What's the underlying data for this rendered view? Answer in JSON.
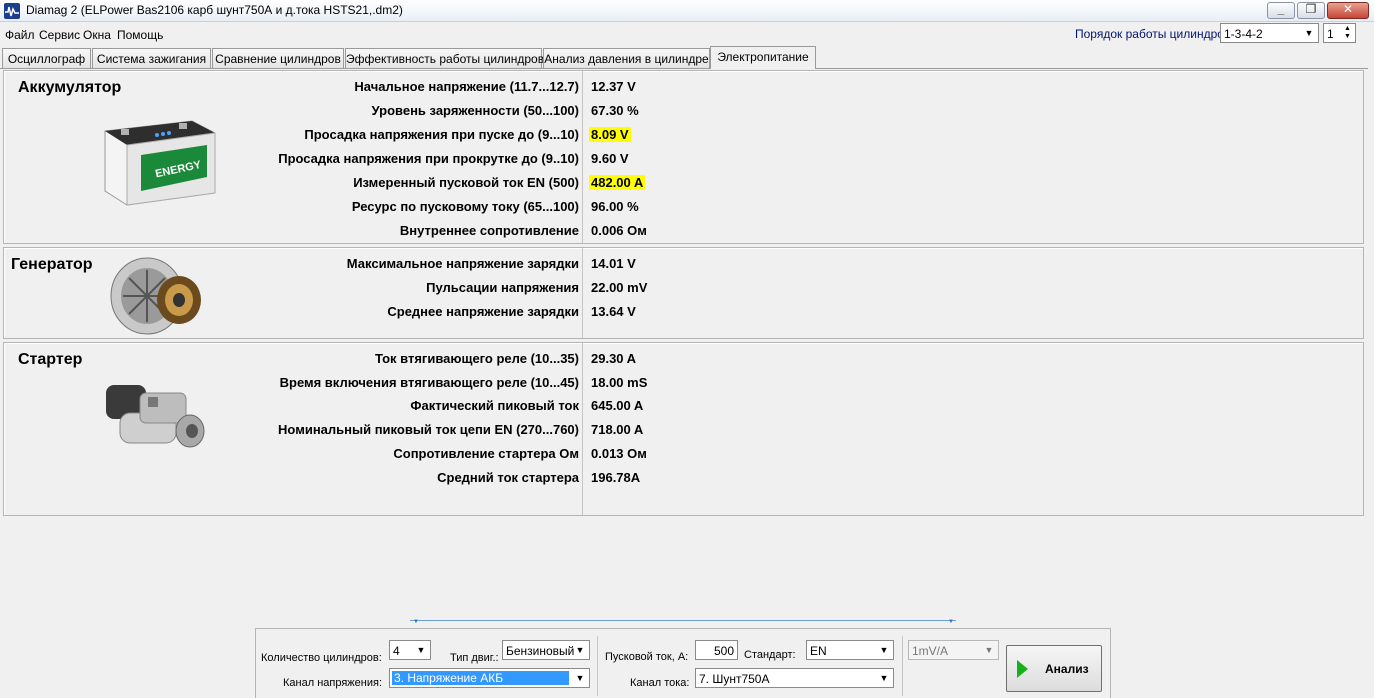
{
  "window": {
    "title": "Diamag 2 (ELPower Bas2106 карб шунт750А и д.тока HSTS21,.dm2)",
    "btn_min": "_",
    "btn_max": "❐",
    "btn_close": "✕"
  },
  "menu": [
    "Файл",
    "Сервис",
    "Окна",
    "Помощь"
  ],
  "cylinder_order": {
    "label": "Порядок работы цилиндров",
    "value": "1-3-4-2",
    "spin_value": "1"
  },
  "tabs": [
    {
      "label": "Осциллограф"
    },
    {
      "label": "Система зажигания"
    },
    {
      "label": "Сравнение цилиндров"
    },
    {
      "label": "Эффективность работы цилиндров"
    },
    {
      "label": "Анализ давления в цилиндре"
    },
    {
      "label": "Электропитание",
      "active": true
    }
  ],
  "battery": {
    "title": "Аккумулятор",
    "image_text": "ENERGY",
    "rows": [
      {
        "label": "Начальное напряжение (11.7...12.7)",
        "value": "12.37 V",
        "highlight": false
      },
      {
        "label": "Уровень заряженности (50...100)",
        "value": "67.30 %",
        "highlight": false
      },
      {
        "label": "Просадка напряжения при пуске до (9...10)",
        "value": "8.09 V",
        "highlight": true
      },
      {
        "label": "Просадка напряжения при прокрутке до  (9..10)",
        "value": "9.60 V",
        "highlight": false
      },
      {
        "label": "Измеренный пусковой ток  EN (500)",
        "value": "482.00 A",
        "highlight": true
      },
      {
        "label": "Ресурс по пусковому току (65...100)",
        "value": "96.00 %",
        "highlight": false
      },
      {
        "label": "Внутреннее сопротивление",
        "value": "0.006 Ом",
        "highlight": false
      }
    ]
  },
  "generator": {
    "title": "Генератор",
    "rows": [
      {
        "label": "Максимальное напряжение зарядки",
        "value": "14.01 V"
      },
      {
        "label": "Пульсации напряжения",
        "value": "22.00 mV"
      },
      {
        "label": "Среднее напряжение зарядки",
        "value": "13.64 V"
      }
    ]
  },
  "starter": {
    "title": "Стартер",
    "rows": [
      {
        "label": "Ток втягивающего реле (10...35)",
        "value": "29.30 A"
      },
      {
        "label": "Время включения втягивающего реле (10...45)",
        "value": "18.00 mS"
      },
      {
        "label": "Фактический пиковый ток",
        "value": "645.00 A"
      },
      {
        "label": "Номинальный пиковый ток цепи EN (270...760)",
        "value": "718.00 A"
      },
      {
        "label": "Сопротивление стартера Ом",
        "value": "0.013 Ом"
      },
      {
        "label": "Средний ток стартера",
        "value": "196.78A"
      }
    ]
  },
  "controls": {
    "cyl_count_label": "Количество цилиндров:",
    "cyl_count_value": "4",
    "engine_type_label": "Тип двиг.:",
    "engine_type_value": "Бензиновый",
    "voltage_channel_label": "Канал напряжения:",
    "voltage_channel_value": "3. Напряжение АКБ",
    "start_current_label": "Пусковой ток, А:",
    "start_current_value": "500",
    "standard_label": "Стандарт:",
    "standard_value": "EN",
    "current_channel_label": "Канал тока:",
    "current_channel_value": "7. Шунт750А",
    "scale_value": "1mV/A",
    "analyze_label": "Анализ"
  },
  "colors": {
    "highlight": "#ffff00",
    "link_blue": "#00156e",
    "selection": "#3399ff",
    "play_green": "#18b018"
  }
}
